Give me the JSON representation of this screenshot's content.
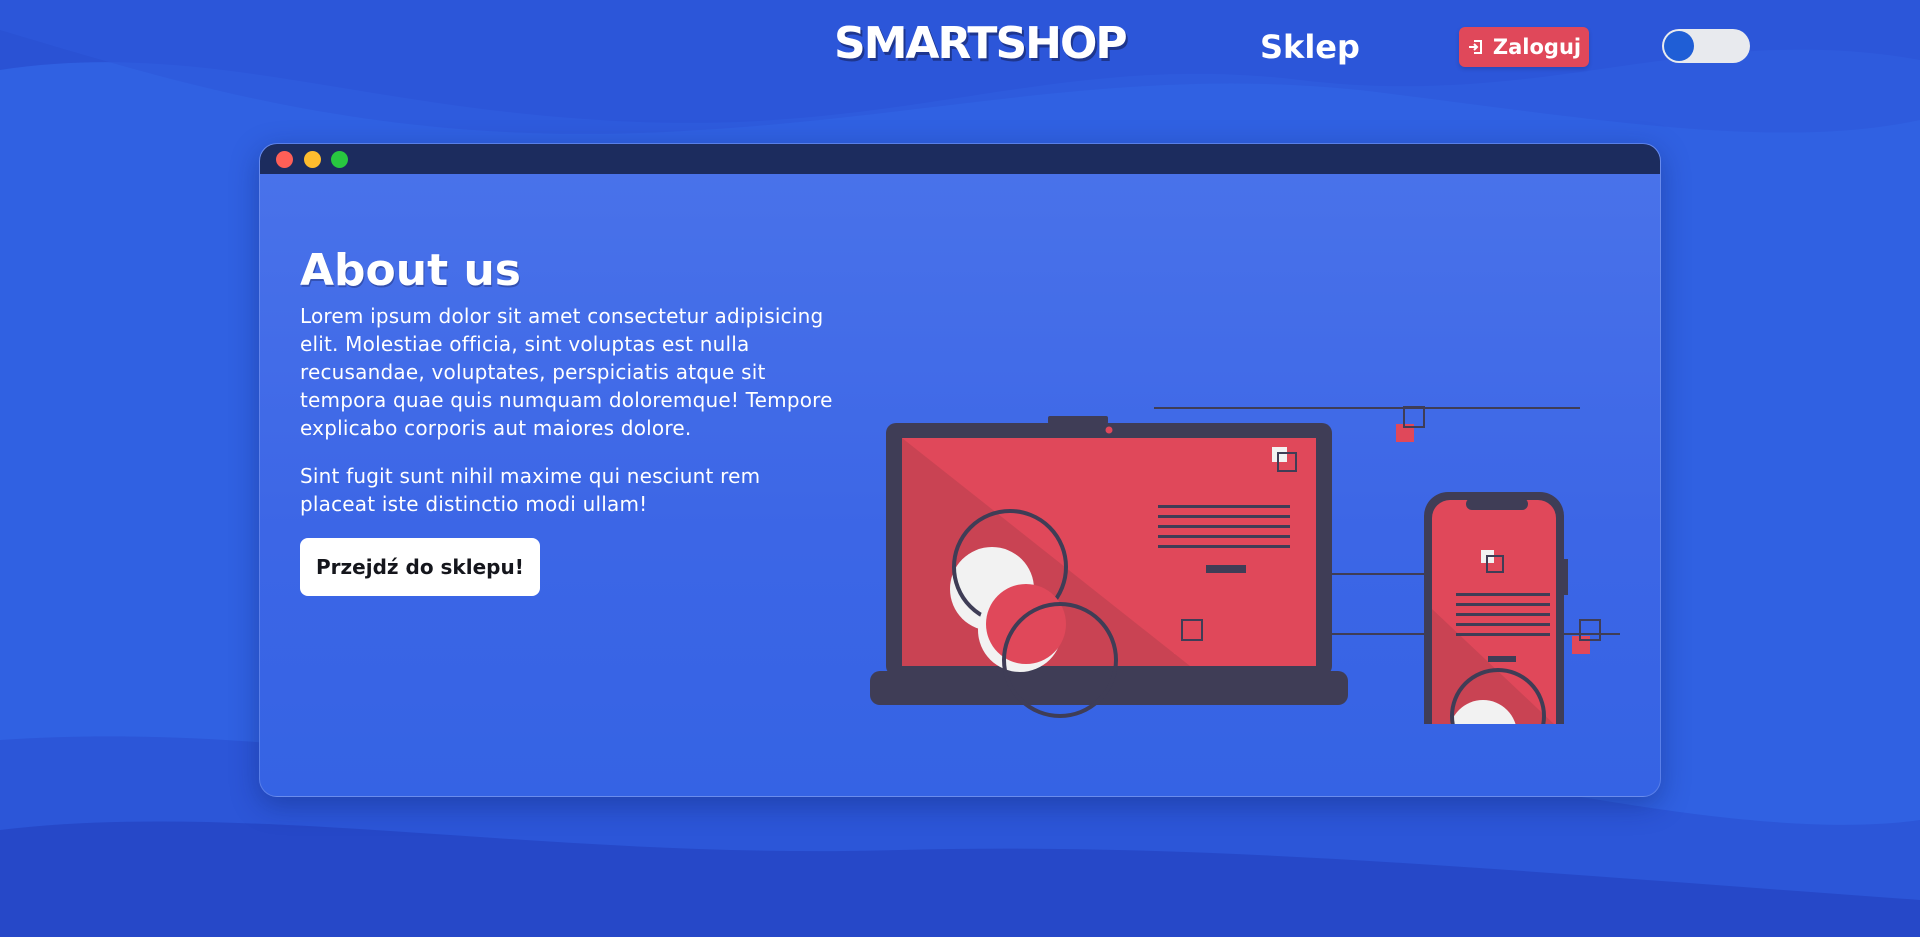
{
  "header": {
    "brand": "SMARTSHOP",
    "nav_shop": "Sklep",
    "login_label": "Zaloguj",
    "login_icon": "sign-in-icon",
    "theme_toggle": "theme-toggle"
  },
  "window": {
    "title_buttons": [
      "close",
      "minimize",
      "maximize"
    ]
  },
  "about": {
    "title": "About us",
    "paragraph_1": "Lorem ipsum dolor sit amet consectetur adipisicing elit. Molestiae officia, sint voluptas est nulla recusandae, voluptates, perspiciatis atque sit tempora quae quis numquam doloremque! Tempore explicabo corporis aut maiores dolore.",
    "paragraph_2": "Sint fugit sunt nihil maxime qui nesciunt rem placeat iste distinctio modi ullam!",
    "cta_label": "Przejdź do sklepu!"
  },
  "colors": {
    "background": "#2f5fe0",
    "accent_red": "#e0485a",
    "titlebar": "#1c2c5e",
    "device_dark": "#3f3d56",
    "toggle_knob": "#1f5ed6"
  },
  "illustration": {
    "icon": "devices-illustration"
  }
}
